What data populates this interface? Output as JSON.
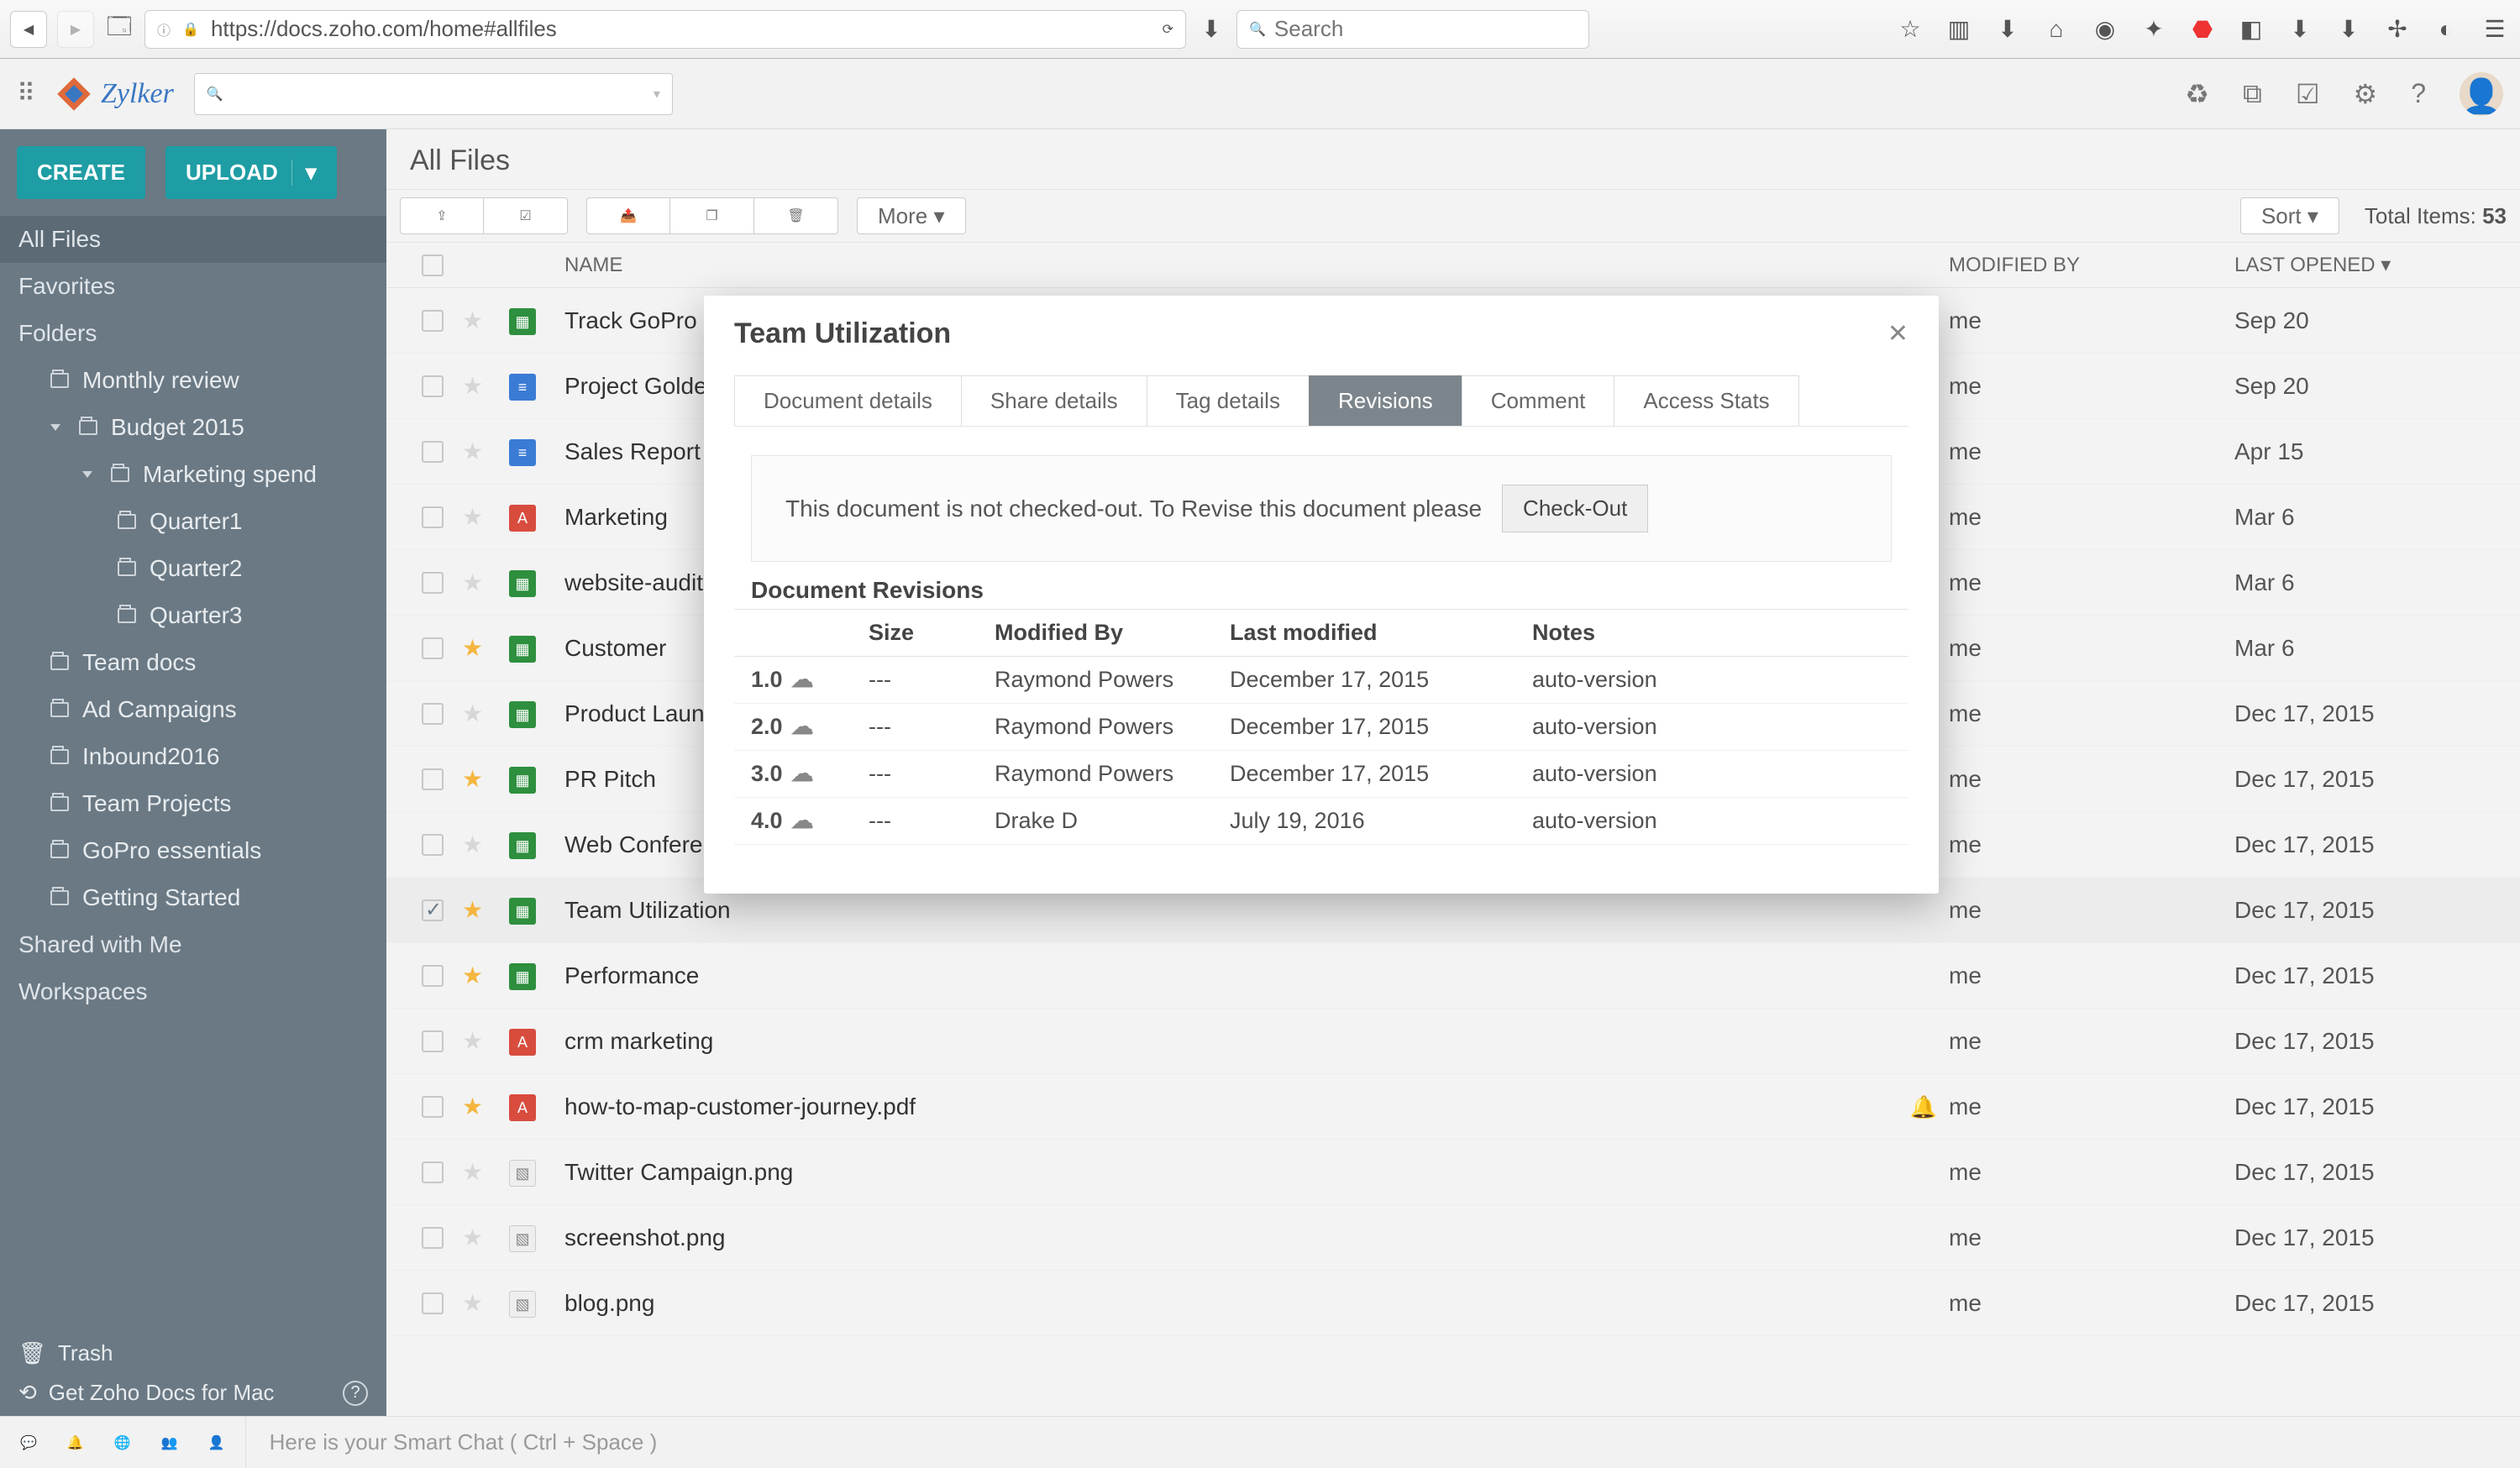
{
  "browser": {
    "url": "https://docs.zoho.com/home#allfiles",
    "search_placeholder": "Search"
  },
  "brand": "Zylker",
  "buttons": {
    "create": "CREATE",
    "upload": "UPLOAD",
    "more": "More",
    "sort": "Sort"
  },
  "sidebar": {
    "items": [
      "All Files",
      "Favorites",
      "Folders",
      "Monthly review",
      "Budget 2015",
      "Marketing spend",
      "Quarter1",
      "Quarter2",
      "Quarter3",
      "Team docs",
      "Ad Campaigns",
      "Inbound2016",
      "Team Projects",
      "GoPro essentials",
      "Getting Started",
      "Shared with Me",
      "Workspaces"
    ],
    "trash": "Trash",
    "mac": "Get Zoho Docs for Mac"
  },
  "main": {
    "title": "All Files",
    "total_label": "Total Items:",
    "total": "53",
    "columns": {
      "name": "NAME",
      "mod": "MODIFIED BY",
      "date": "LAST OPENED"
    }
  },
  "files": [
    {
      "name": "Track GoPro",
      "mod": "me",
      "date": "Sep 20",
      "star": false,
      "type": "sheet",
      "checked": false,
      "bell": false
    },
    {
      "name": "Project Goldenrod",
      "mod": "me",
      "date": "Sep 20",
      "star": false,
      "type": "doc",
      "checked": false,
      "bell": false
    },
    {
      "name": "Sales Report",
      "mod": "me",
      "date": "Apr 15",
      "star": false,
      "type": "doc",
      "checked": false,
      "bell": false
    },
    {
      "name": "Marketing",
      "mod": "me",
      "date": "Mar 6",
      "star": false,
      "type": "pdf",
      "checked": false,
      "bell": false
    },
    {
      "name": "website-audit",
      "mod": "me",
      "date": "Mar 6",
      "star": false,
      "type": "sheet",
      "checked": false,
      "bell": false
    },
    {
      "name": "Customer",
      "mod": "me",
      "date": "Mar 6",
      "star": true,
      "type": "sheet",
      "checked": false,
      "bell": false
    },
    {
      "name": "Product Launch",
      "mod": "me",
      "date": "Dec 17, 2015",
      "star": false,
      "type": "sheet",
      "checked": false,
      "bell": false
    },
    {
      "name": "PR Pitch",
      "mod": "me",
      "date": "Dec 17, 2015",
      "star": true,
      "type": "sheet",
      "checked": false,
      "bell": false
    },
    {
      "name": "Web Conference",
      "mod": "me",
      "date": "Dec 17, 2015",
      "star": false,
      "type": "sheet",
      "checked": false,
      "bell": false
    },
    {
      "name": "Team Utilization",
      "mod": "me",
      "date": "Dec 17, 2015",
      "star": true,
      "type": "sheet",
      "checked": true,
      "bell": false
    },
    {
      "name": "Performance",
      "mod": "me",
      "date": "Dec 17, 2015",
      "star": true,
      "type": "sheet",
      "checked": false,
      "bell": false
    },
    {
      "name": "crm marketing",
      "mod": "me",
      "date": "Dec 17, 2015",
      "star": false,
      "type": "pdf",
      "checked": false,
      "bell": false
    },
    {
      "name": "how-to-map-customer-journey.pdf",
      "mod": "me",
      "date": "Dec 17, 2015",
      "star": true,
      "type": "pdf",
      "checked": false,
      "bell": true
    },
    {
      "name": "Twitter Campaign.png",
      "mod": "me",
      "date": "Dec 17, 2015",
      "star": false,
      "type": "img",
      "checked": false,
      "bell": false
    },
    {
      "name": "screenshot.png",
      "mod": "me",
      "date": "Dec 17, 2015",
      "star": false,
      "type": "img",
      "checked": false,
      "bell": false
    },
    {
      "name": "blog.png",
      "mod": "me",
      "date": "Dec 17, 2015",
      "star": false,
      "type": "img",
      "checked": false,
      "bell": false
    }
  ],
  "modal": {
    "title": "Team Utilization",
    "tabs": [
      "Document details",
      "Share details",
      "Tag details",
      "Revisions",
      "Comment",
      "Access Stats"
    ],
    "active_tab": 3,
    "revise_msg": "This document is not checked-out. To Revise this document please",
    "checkout": "Check-Out",
    "rev_title": "Document Revisions",
    "rev_cols": {
      "size": "Size",
      "by": "Modified By",
      "date": "Last modified",
      "notes": "Notes"
    },
    "revisions": [
      {
        "ver": "1.0",
        "size": "---",
        "by": "Raymond Powers",
        "date": "December 17, 2015",
        "notes": "auto-version"
      },
      {
        "ver": "2.0",
        "size": "---",
        "by": "Raymond Powers",
        "date": "December 17, 2015",
        "notes": "auto-version"
      },
      {
        "ver": "3.0",
        "size": "---",
        "by": "Raymond Powers",
        "date": "December 17, 2015",
        "notes": "auto-version"
      },
      {
        "ver": "4.0",
        "size": "---",
        "by": "Drake D",
        "date": "July 19, 2016",
        "notes": "auto-version"
      }
    ]
  },
  "chat_hint": "Here is your Smart Chat ( Ctrl + Space )"
}
